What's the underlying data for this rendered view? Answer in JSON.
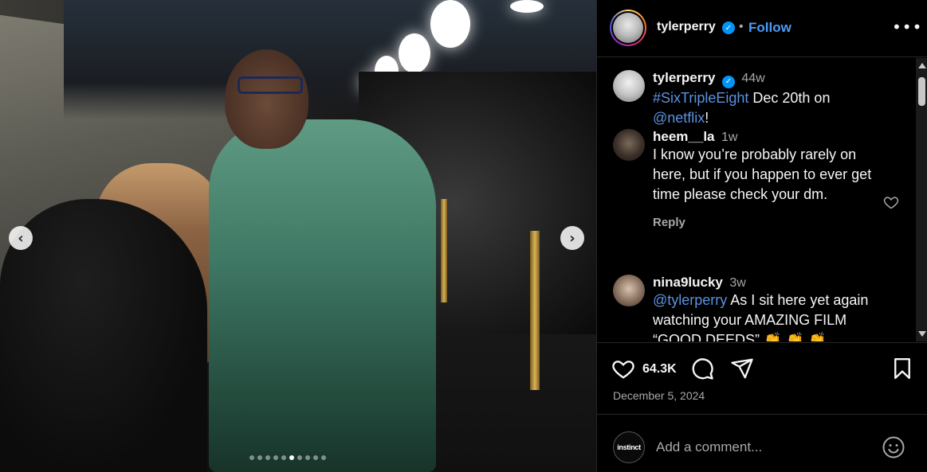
{
  "post": {
    "username": "tylerperry",
    "verified_mark": "✓",
    "separator": "•",
    "follow_label": "Follow",
    "more_label": "•••"
  },
  "carousel": {
    "prev_label": "‹",
    "next_label": "›",
    "slide_count": 10,
    "active_index": 5
  },
  "comments": [
    {
      "username": "tylerperry",
      "time": "44w",
      "verified": true,
      "parts": [
        {
          "text": "#SixTripleEight",
          "link": true
        },
        {
          "text": " Dec 20th on ",
          "link": false
        },
        {
          "text": "@netflix",
          "link": true
        },
        {
          "text": "!",
          "link": false
        }
      ]
    },
    {
      "username": "heem__la",
      "time": "1w",
      "text": "I know you’re probably rarely on here, but if you happen to ever get time please check your dm.",
      "reply_label": "Reply"
    },
    {
      "username": "nina9lucky",
      "time": "3w",
      "mention": "@tylerperry",
      "text": " As I sit here yet again watching your AMAZING FILM “GOOD DEEDS” ",
      "emoji": "👏 👏 👏"
    }
  ],
  "actions": {
    "like_count": "64.3K",
    "date": "December 5, 2024"
  },
  "composer": {
    "avatar_text": "instinct",
    "placeholder": "Add a comment..."
  },
  "colors": {
    "link": "#5b92e0",
    "follow": "#4a9cf6",
    "verified": "#0095f6",
    "muted": "#a8a8a8"
  }
}
